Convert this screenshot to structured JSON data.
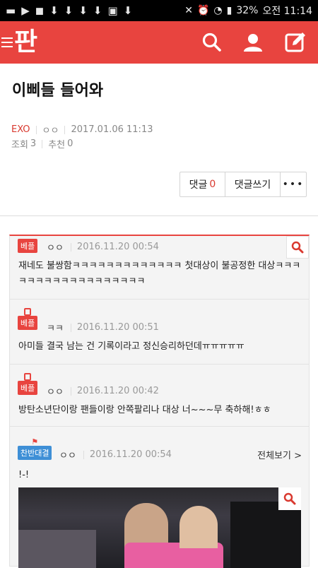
{
  "status_bar": {
    "battery": "32%",
    "time": "오전 11:14"
  },
  "app": {
    "logo": "판",
    "colors": {
      "brand": "#e8443f",
      "blue_badge": "#3e8fd6"
    }
  },
  "post": {
    "title": "이삐들 들어와",
    "category": "EXO",
    "author": "ㅇㅇ",
    "date": "2017.01.06 11:13",
    "views_label": "조회",
    "views": "3",
    "recommend_label": "추천",
    "recommend": "0"
  },
  "actions": {
    "comment_label": "댓글",
    "comment_count": "0",
    "write_comment_label": "댓글쓰기",
    "more": "•••"
  },
  "best_comments": [
    {
      "badge": "베플",
      "author": "ㅇㅇ",
      "date": "2016.11.20 00:54",
      "text": "재네도 불쌍함ㅋㅋㅋㅋㅋㅋㅋㅋㅋㅋㅋㅋㅋ 첫대상이 불공정한 대상ㅋㅋㅋㅋㅋㅋㅋㅋㅋㅋㅋㅋㅋㅋㅋㅋㅋㅋ"
    },
    {
      "badge": "베플",
      "author": "ㅋㅋ",
      "date": "2016.11.20 00:51",
      "text": "아미들 결국 남는 건 기록이라고 정신승리하던데ㅠㅠㅠㅠㅠ"
    },
    {
      "badge": "베플",
      "author": "ㅇㅇ",
      "date": "2016.11.20 00:42",
      "text": "방탄소년단이랑 팬들이랑 안쪽팔리나 대상 너~~~무 축하해!ㅎㅎ"
    },
    {
      "badge": "찬반대결",
      "author": "ㅇㅇ",
      "date": "2016.11.20 00:54",
      "view_all": "전체보기 >",
      "text": "!-!"
    }
  ]
}
